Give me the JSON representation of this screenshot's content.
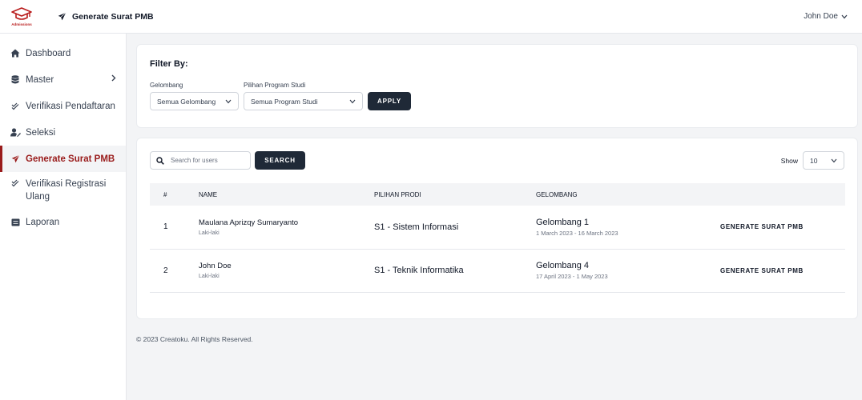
{
  "app": {
    "logo_text": "Admissions",
    "page_title": "Generate Surat PMB",
    "user_name": "John Doe"
  },
  "sidebar": {
    "items": [
      {
        "label": "Dashboard",
        "icon": "home-icon"
      },
      {
        "label": "Master",
        "icon": "database-icon"
      },
      {
        "label": "Verifikasi Pendaftaran",
        "icon": "check-double-icon"
      },
      {
        "label": "Seleksi",
        "icon": "user-edit-icon"
      },
      {
        "label": "Generate Surat PMB",
        "icon": "send-icon"
      },
      {
        "label": "Verifikasi Registrasi Ulang",
        "icon": "check-double-icon"
      },
      {
        "label": "Laporan",
        "icon": "report-icon"
      }
    ]
  },
  "filter": {
    "title": "Filter By:",
    "gelombang_label": "Gelombang",
    "gelombang_value": "Semua Gelombang",
    "prodi_label": "Pilihan Program Studi",
    "prodi_value": "Semua Program Studi",
    "apply_label": "APPLY"
  },
  "table_toolbar": {
    "search_placeholder": "Search for users",
    "search_label": "SEARCH",
    "show_label": "Show",
    "show_value": "10"
  },
  "table": {
    "headers": [
      "#",
      "NAME",
      "PILIHAN PRODI",
      "GELOMBANG",
      ""
    ],
    "rows": [
      {
        "no": "1",
        "name": "Maulana Aprizqy Sumaryanto",
        "gender": "Laki-laki",
        "prodi": "S1 - Sistem Informasi",
        "gelombang": "Gelombang 1",
        "periode": "1 March 2023 - 16 March 2023",
        "action": "GENERATE SURAT PMB"
      },
      {
        "no": "2",
        "name": "John Doe",
        "gender": "Laki-laki",
        "prodi": "S1 - Teknik Informatika",
        "gelombang": "Gelombang 4",
        "periode": "17 April 2023 - 1 May 2023",
        "action": "GENERATE SURAT PMB"
      }
    ]
  },
  "footer": {
    "text": "© 2023 Creatoku. All Rights Reserved."
  },
  "colors": {
    "accent": "#991b1b",
    "dark_button": "#1f2937",
    "background": "#f3f4f6"
  }
}
